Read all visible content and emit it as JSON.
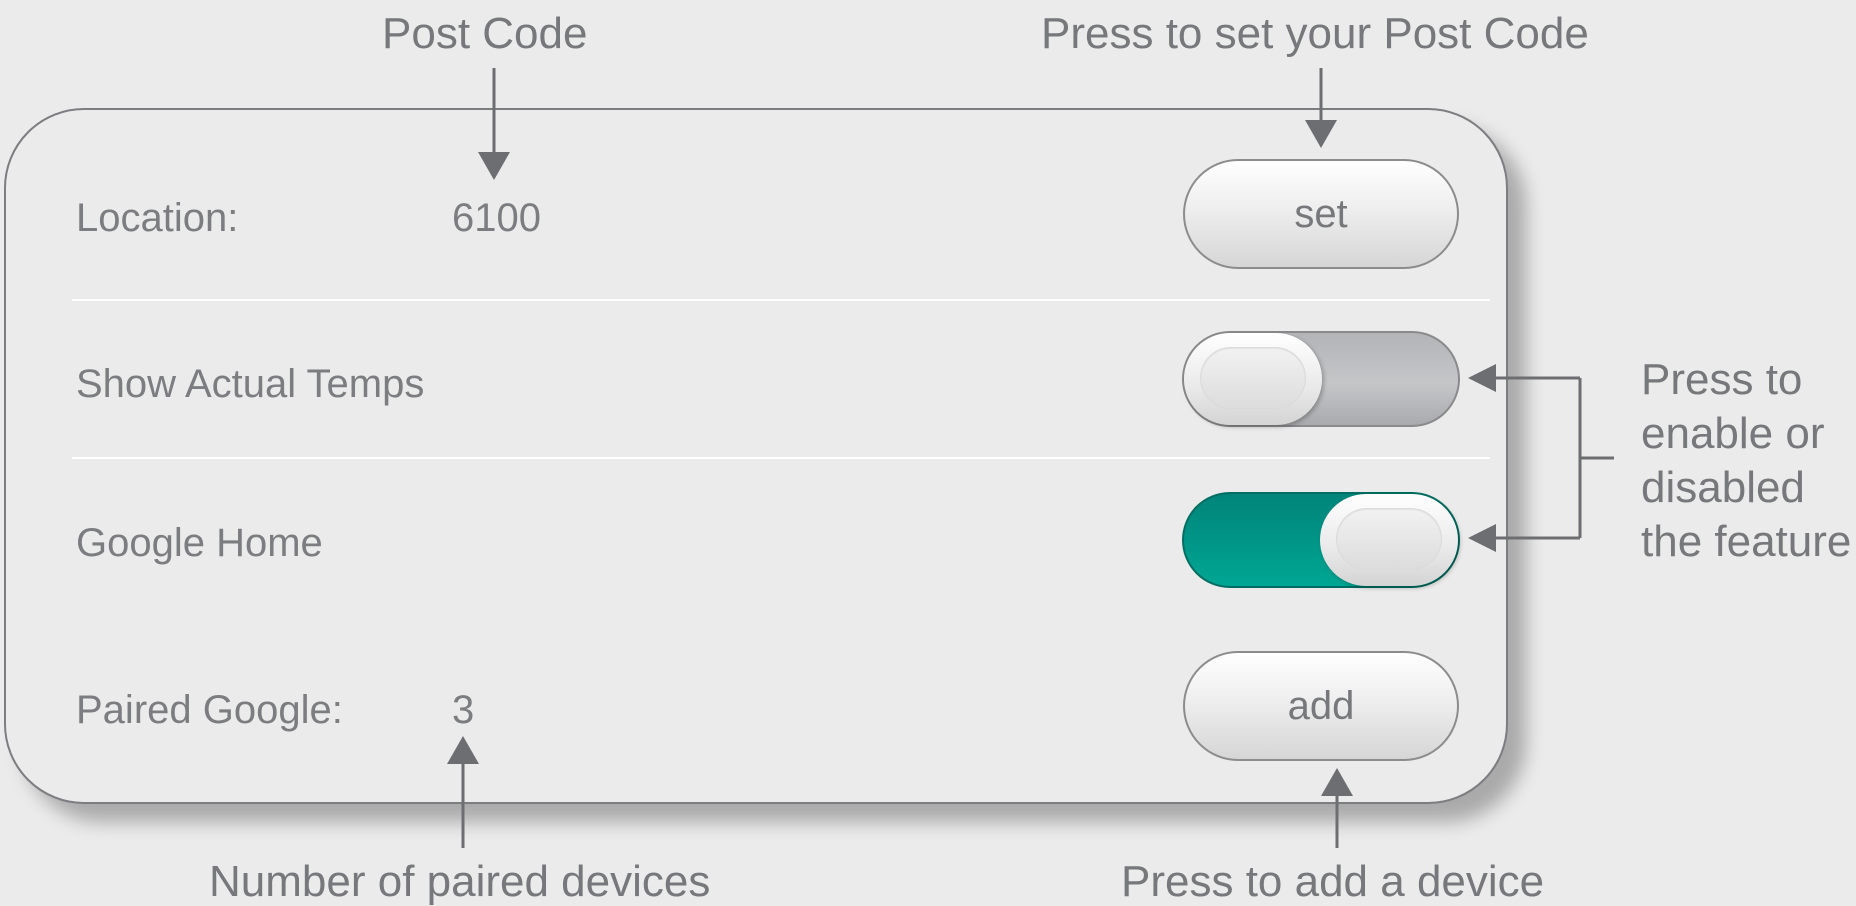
{
  "annotations": {
    "post_code": "Post Code",
    "set_post_code": "Press to set your Post Code",
    "toggle_help": [
      "Press to",
      "enable or",
      "disabled",
      "the feature"
    ],
    "paired_count": "Number of paired devices",
    "add_device": "Press to add a device"
  },
  "settings": {
    "location_label": "Location:",
    "location_value": "6100",
    "set_button": "set",
    "show_temps_label": "Show Actual Temps",
    "show_temps_enabled": false,
    "google_home_label": "Google Home",
    "google_home_enabled": true,
    "paired_label": "Paired Google:",
    "paired_value": "3",
    "add_button": "add"
  },
  "colors": {
    "background": "#ebebeb",
    "text": "#7a7a7c",
    "toggle_on": "#009a8a",
    "toggle_off": "#b7b8ba",
    "arrow": "#6d6e71"
  }
}
